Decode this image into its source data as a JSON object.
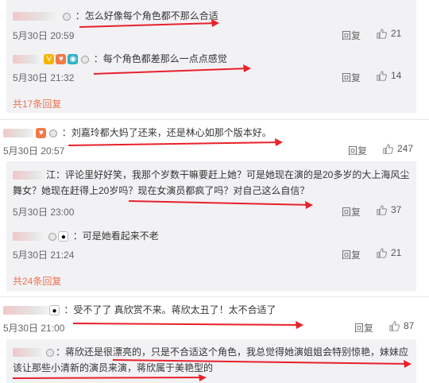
{
  "comments": [
    {
      "text": "：怎么好像每个角色都不那么合适",
      "time": "5月30日 20:59",
      "reply": "回复",
      "likes": "21",
      "icons": [
        "medal-icon"
      ]
    },
    {
      "text": "：每个角色都差那么一点点感觉",
      "time": "5月30日 21:32",
      "reply": "回复",
      "likes": "14",
      "icons": [
        "star-icon",
        "heart-badge-icon",
        "camera-icon",
        "medal-icon"
      ]
    },
    {
      "more": "共17条回复"
    },
    {
      "text": "：刘嘉玲都大妈了还来，还是林心如那个版本好。",
      "time": "5月30日 20:57",
      "reply": "回复",
      "likes": "247",
      "icons": [
        "heart-badge-icon",
        "medal-icon"
      ]
    },
    {
      "text_line1": "江：评论里好好笑，我那个岁数干嘛要赶上她？可是她现在演的是20多岁的大上海风尘",
      "text_line2": "舞女？她现在赶得上20岁吗？现在女演员都疯了吗？对自己这么自信？",
      "time": "5月30日 23:00",
      "reply": "回复",
      "likes": "37"
    },
    {
      "text": "：可是她看起来不老",
      "time": "5月30日 21:24",
      "reply": "回复",
      "likes": "21",
      "icons": [
        "medal-icon",
        "panda-icon"
      ]
    },
    {
      "more": "共24条回复"
    },
    {
      "text": "：受不了了 真欣赏不来。蒋欣太丑了！太不合适了",
      "time": "5月30日 21:00",
      "reply": "回复",
      "likes": "87",
      "icons": [
        "panda-icon"
      ]
    },
    {
      "text_line1": "：蒋欣还是很漂亮的，只是不合适这个角色，我总觉得她演姐姐会特别惊艳，妹妹应",
      "text_line2": "该让那些小清新的演员来演，蒋欣属于美艳型的",
      "icons": [
        "medal-icon"
      ]
    }
  ],
  "colors": {
    "arrow": "#e8212b",
    "more_link": "#eb7350",
    "sub_background": "#f2f2f5",
    "meta": "#666666"
  }
}
